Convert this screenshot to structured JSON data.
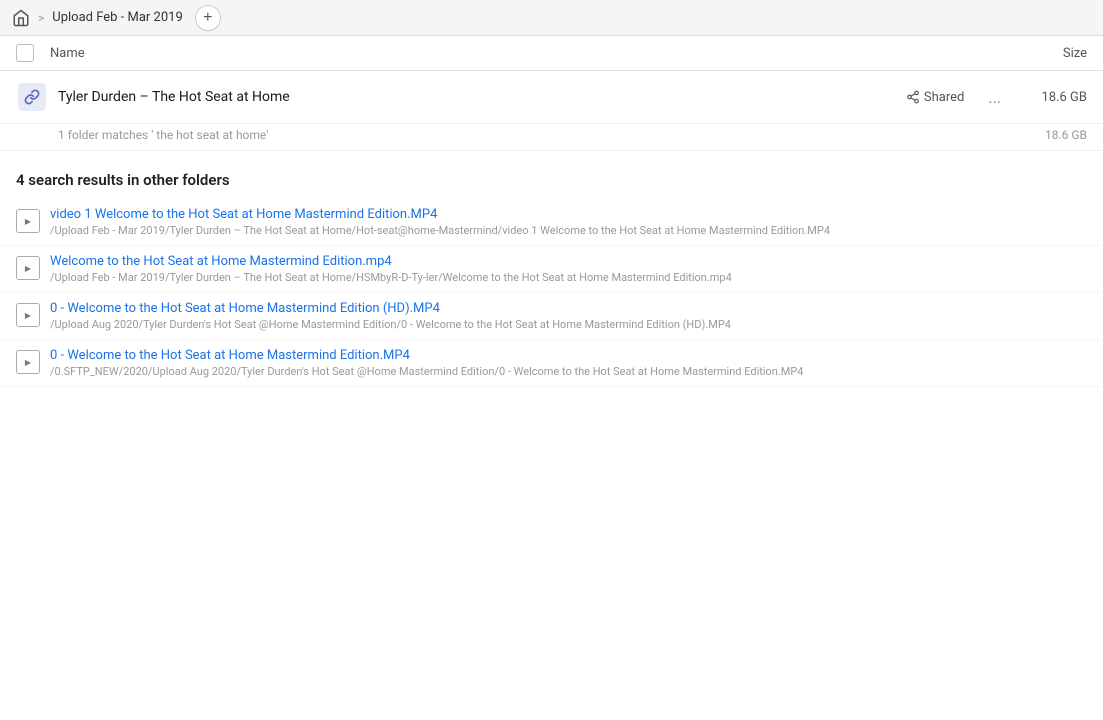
{
  "topbar": {
    "home_icon": "home",
    "breadcrumb_arrow": ">",
    "title": "Upload Feb - Mar 2019",
    "add_button_label": "+"
  },
  "column_header": {
    "name_label": "Name",
    "size_label": "Size"
  },
  "main_folder": {
    "icon": "🔗",
    "name": "Tyler Durden – The Hot Seat at Home",
    "shared_label": "Shared",
    "more_label": "...",
    "size": "18.6 GB",
    "sub_info": "1 folder matches ' the hot seat at home'",
    "sub_size": "18.6 GB"
  },
  "search_results": {
    "header": "4 search results in other folders",
    "items": [
      {
        "name": "video 1 Welcome to the Hot Seat at Home Mastermind Edition.MP4",
        "path": "/Upload Feb - Mar 2019/Tyler Durden – The Hot Seat at Home/Hot-seat@home-Mastermind/video 1 Welcome to the Hot Seat at Home Mastermind Edition.MP4"
      },
      {
        "name": "Welcome to the Hot Seat at Home Mastermind Edition.mp4",
        "path": "/Upload Feb - Mar 2019/Tyler Durden – The Hot Seat at Home/HSMbyR-D-Ty-ler/Welcome to the Hot Seat at Home Mastermind Edition.mp4"
      },
      {
        "name": "0 - Welcome to the Hot Seat at Home Mastermind Edition (HD).MP4",
        "path": "/Upload Aug 2020/Tyler Durden's Hot Seat @Home Mastermind Edition/0 - Welcome to the Hot Seat at Home Mastermind Edition (HD).MP4"
      },
      {
        "name": "0 - Welcome to the Hot Seat at Home Mastermind Edition.MP4",
        "path": "/0.SFTP_NEW/2020/Upload Aug 2020/Tyler Durden's Hot Seat @Home Mastermind Edition/0 - Welcome to the Hot Seat at Home Mastermind Edition.MP4"
      }
    ]
  }
}
